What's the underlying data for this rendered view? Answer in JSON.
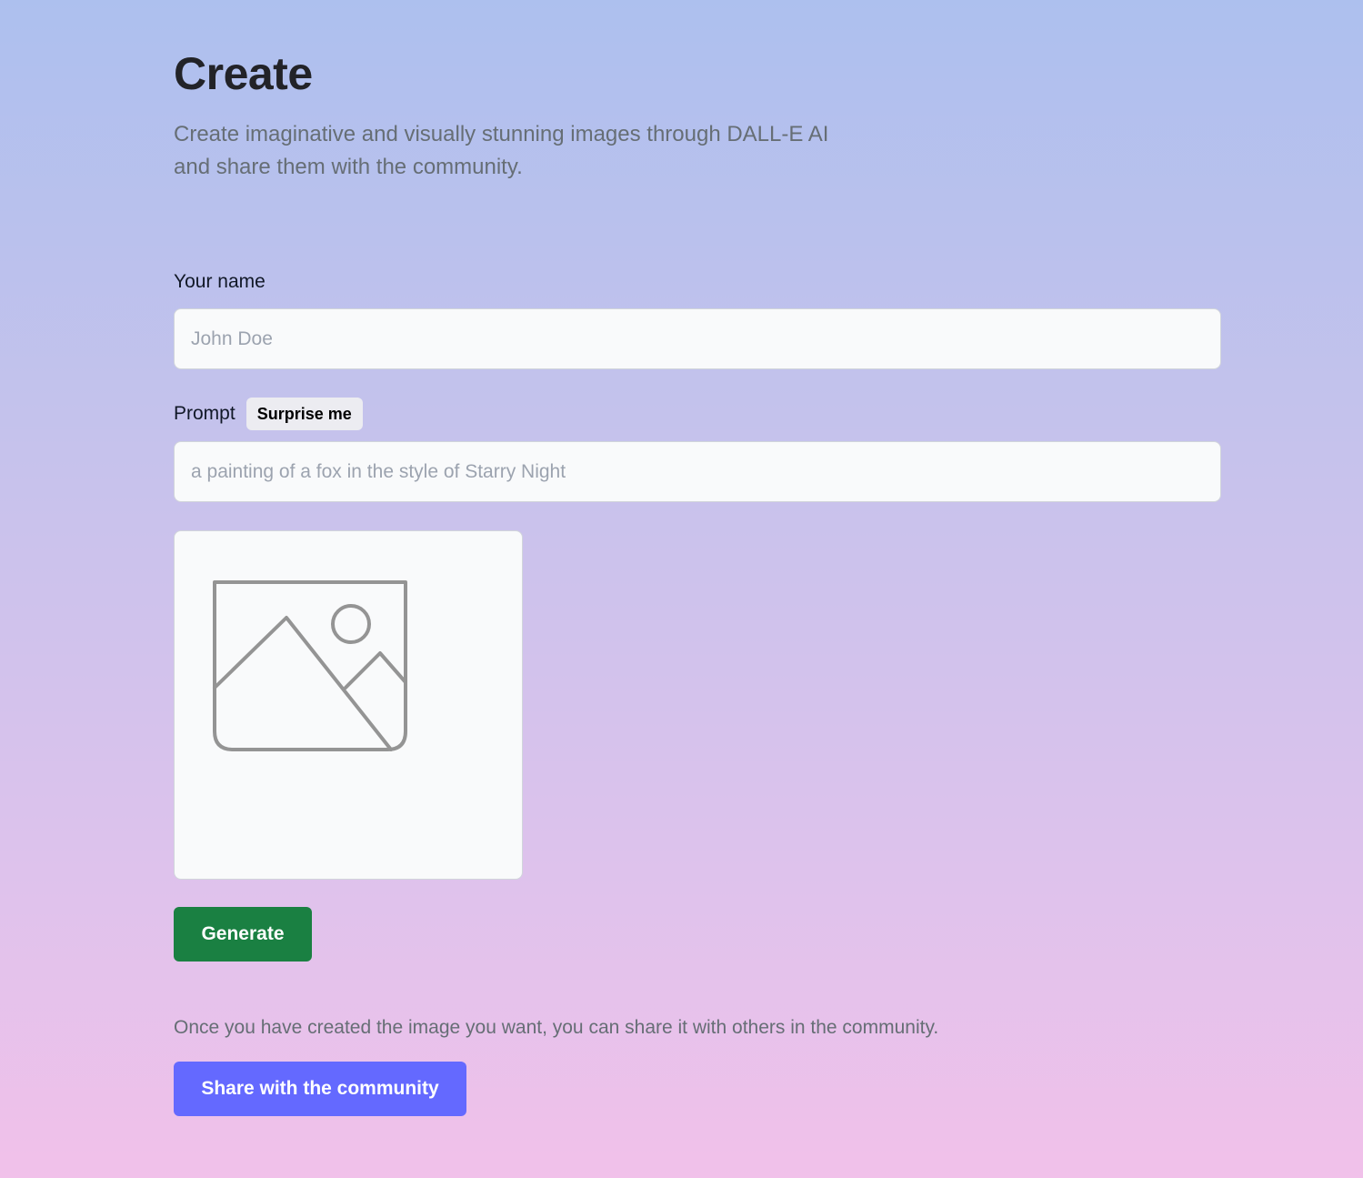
{
  "header": {
    "title": "Create",
    "subtitle": "Create imaginative and visually stunning images through DALL-E AI and share them with the community."
  },
  "form": {
    "name_label": "Your name",
    "name_value": "",
    "name_placeholder": "John Doe",
    "prompt_label": "Prompt",
    "surprise_label": "Surprise me",
    "prompt_value": "",
    "prompt_placeholder": "a painting of a fox in the style of Starry Night",
    "preview_icon": "image-placeholder-icon",
    "generate_label": "Generate"
  },
  "share": {
    "note": "Once you have created the image you want, you can share it with others in the community.",
    "button_label": "Share with the community"
  },
  "colors": {
    "generate_button": "#1a8042",
    "share_button": "#6469ff",
    "heading": "#222328",
    "muted_text": "#666e75"
  }
}
